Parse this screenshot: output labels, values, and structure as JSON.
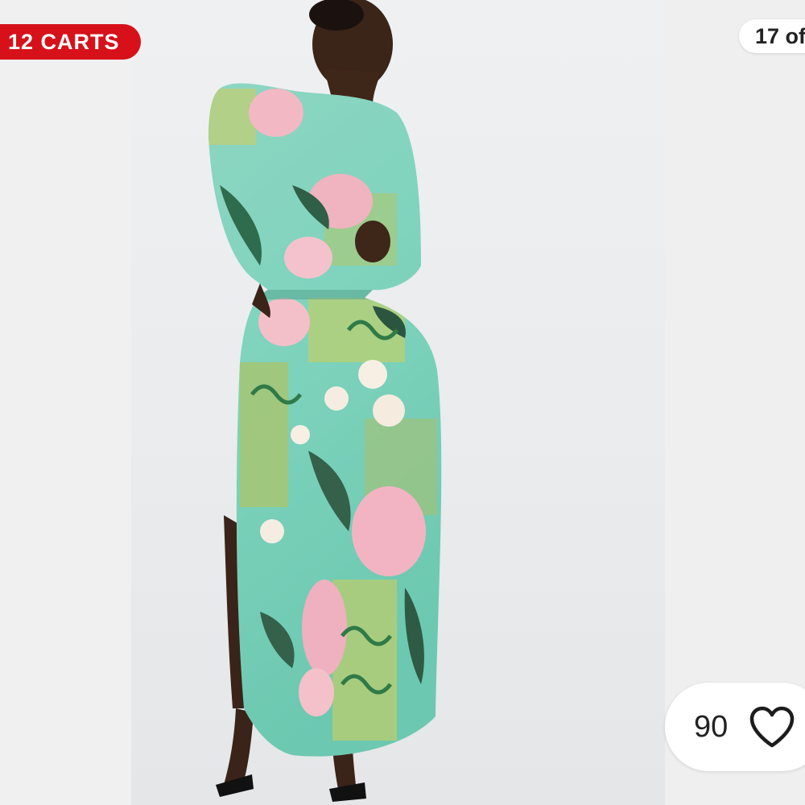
{
  "badge": {
    "carts_text": "12 CARTS",
    "color": "#d7111a"
  },
  "gallery": {
    "counter_text": "17 of"
  },
  "likes": {
    "count": "90",
    "icon": "heart-outline-icon"
  },
  "photo": {
    "subject": "model-back-view-floral-dress",
    "dress_colors": [
      "#7fd3bd",
      "#a8c97a",
      "#f2b8c3",
      "#2f6b4d"
    ]
  }
}
